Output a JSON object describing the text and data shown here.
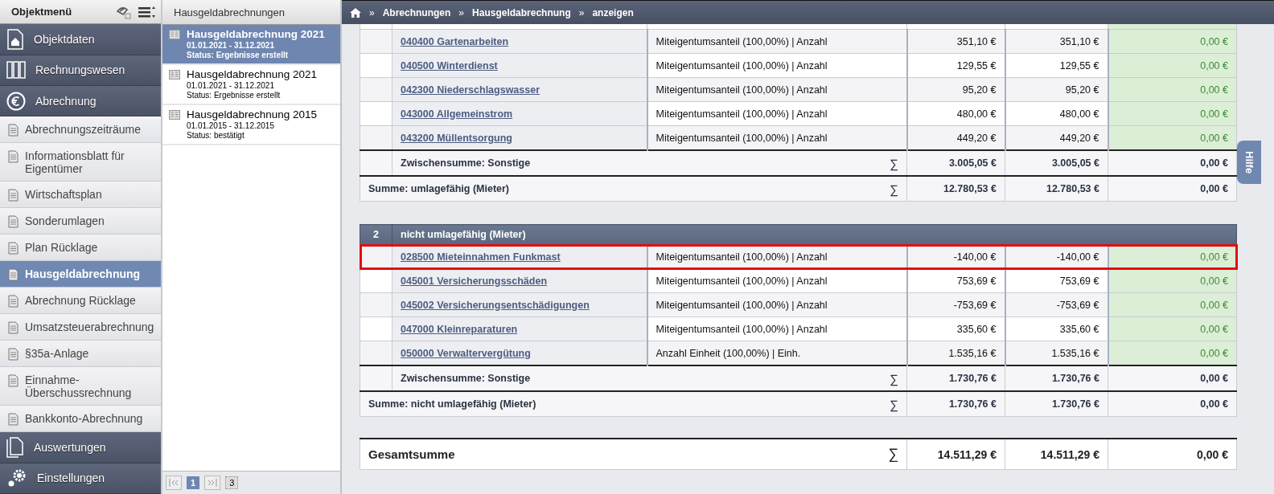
{
  "sidebar": {
    "title": "Objektmenü",
    "items": [
      {
        "label": "Objektdaten",
        "kind": "section",
        "selected": false
      },
      {
        "label": "Rechnungswesen",
        "kind": "section",
        "selected": false
      },
      {
        "label": "Abrechnung",
        "kind": "section",
        "selected": false
      },
      {
        "label": "Abrechnungszeiträume",
        "kind": "page",
        "selected": false
      },
      {
        "label": "Informationsblatt für Eigentümer",
        "kind": "page",
        "selected": false
      },
      {
        "label": "Wirtschaftsplan",
        "kind": "page",
        "selected": false
      },
      {
        "label": "Sonderumlagen",
        "kind": "page",
        "selected": false
      },
      {
        "label": "Plan Rücklage",
        "kind": "page",
        "selected": false
      },
      {
        "label": "Hausgeldabrechnung",
        "kind": "page",
        "selected": true
      },
      {
        "label": "Abrechnung Rücklage",
        "kind": "page",
        "selected": false
      },
      {
        "label": "Umsatzsteuerabrechnung",
        "kind": "page",
        "selected": false
      },
      {
        "label": "§35a-Anlage",
        "kind": "page",
        "selected": false
      },
      {
        "label": "Einnahme-Überschussrechnung",
        "kind": "page",
        "selected": false
      },
      {
        "label": "Bankkonto-Abrechnung",
        "kind": "page",
        "selected": false
      },
      {
        "label": "Auswertungen",
        "kind": "section",
        "selected": false
      },
      {
        "label": "Einstellungen",
        "kind": "section",
        "selected": false
      }
    ]
  },
  "list_panel": {
    "title": "Hausgeldabrechnungen",
    "items": [
      {
        "title": "Hausgeldabrechnung 2021",
        "period": "01.01.2021 - 31.12.2021",
        "status": "Status: Ergebnisse erstellt",
        "selected": true
      },
      {
        "title": "Hausgeldabrechnung 2021",
        "period": "01.01.2021 - 31.12.2021",
        "status": "Status: Ergebnisse erstellt",
        "selected": false
      },
      {
        "title": "Hausgeldabrechnung 2015",
        "period": "01.01.2015 - 31.12.2015",
        "status": "Status: bestätigt",
        "selected": false
      }
    ],
    "pagination": {
      "current_page": "1",
      "page_count": "3"
    }
  },
  "breadcrumb": {
    "separator": "»",
    "items": [
      "Abrechnungen",
      "Hausgeldabrechnung",
      "anzeigen"
    ]
  },
  "help_tab": "Hilfe",
  "table": {
    "groups": [
      {
        "rows": [
          {
            "account": "040400 Gartenarbeiten",
            "key": "Miteigentumsanteil (100,00%) | Anzahl",
            "column_4": "351,10 €",
            "column_5": "351,10 €",
            "column_6": "0,00 €",
            "highlighted": false
          },
          {
            "account": "040500 Winterdienst",
            "key": "Miteigentumsanteil (100,00%) | Anzahl",
            "column_4": "129,55 €",
            "column_5": "129,55 €",
            "column_6": "0,00 €",
            "highlighted": false
          },
          {
            "account": "042300 Niederschlagswasser",
            "key": "Miteigentumsanteil (100,00%) | Anzahl",
            "column_4": "95,20 €",
            "column_5": "95,20 €",
            "column_6": "0,00 €",
            "highlighted": false
          },
          {
            "account": "043000 Allgemeinstrom",
            "key": "Miteigentumsanteil (100,00%) | Anzahl",
            "column_4": "480,00 €",
            "column_5": "480,00 €",
            "column_6": "0,00 €",
            "highlighted": false
          },
          {
            "account": "043200 Müllentsorgung",
            "key": "Miteigentumsanteil (100,00%) | Anzahl",
            "column_4": "449,20 €",
            "column_5": "449,20 €",
            "column_6": "0,00 €",
            "highlighted": false
          }
        ],
        "subtotal": {
          "label": "Zwischensumme: Sonstige",
          "symbol": "∑",
          "column_4": "3.005,05 €",
          "column_5": "3.005,05 €",
          "column_6": "0,00 €"
        },
        "total": {
          "label": "Summe: umlagefähig (Mieter)",
          "symbol": "∑",
          "column_4": "12.780,53 €",
          "column_5": "12.780,53 €",
          "column_6": "0,00 €"
        }
      },
      {
        "number": "2",
        "title": "nicht umlagefähig (Mieter)",
        "rows": [
          {
            "account": "028500 Mieteinnahmen Funkmast",
            "key": "Miteigentumsanteil (100,00%) | Anzahl",
            "column_4": "-140,00 €",
            "column_5": "-140,00 €",
            "column_6": "0,00 €",
            "highlighted": true
          },
          {
            "account": "045001 Versicherungsschäden",
            "key": "Miteigentumsanteil (100,00%) | Anzahl",
            "column_4": "753,69 €",
            "column_5": "753,69 €",
            "column_6": "0,00 €",
            "highlighted": false
          },
          {
            "account": "045002 Versicherungsentschädigungen",
            "key": "Miteigentumsanteil (100,00%) | Anzahl",
            "column_4": "-753,69 €",
            "column_5": "-753,69 €",
            "column_6": "0,00 €",
            "highlighted": false
          },
          {
            "account": "047000 Kleinreparaturen",
            "key": "Miteigentumsanteil (100,00%) | Anzahl",
            "column_4": "335,60 €",
            "column_5": "335,60 €",
            "column_6": "0,00 €",
            "highlighted": false
          },
          {
            "account": "050000 Verwaltervergütung",
            "key": "Anzahl Einheit (100,00%) | Einh.",
            "column_4": "1.535,16 €",
            "column_5": "1.535,16 €",
            "column_6": "0,00 €",
            "highlighted": false
          }
        ],
        "subtotal": {
          "label": "Zwischensumme: Sonstige",
          "symbol": "∑",
          "column_4": "1.730,76 €",
          "column_5": "1.730,76 €",
          "column_6": "0,00 €"
        },
        "total": {
          "label": "Summe: nicht umlagefähig (Mieter)",
          "symbol": "∑",
          "column_4": "1.730,76 €",
          "column_5": "1.730,76 €",
          "column_6": "0,00 €"
        }
      }
    ],
    "grand_total": {
      "label": "Gesamtsumme",
      "symbol": "∑",
      "column_4": "14.511,29 €",
      "column_5": "14.511,29 €",
      "column_6": "0,00 €"
    }
  }
}
